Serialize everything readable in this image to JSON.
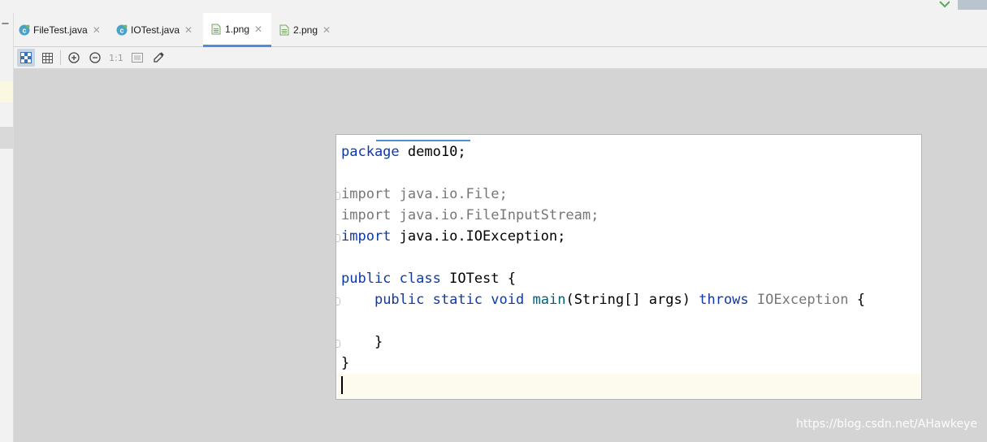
{
  "tabs": [
    {
      "label": "FileTest.java",
      "icon": "java-class-icon",
      "active": false
    },
    {
      "label": "IOTest.java",
      "icon": "java-class-icon",
      "active": false
    },
    {
      "label": "1.png",
      "icon": "image-file-icon",
      "active": true
    },
    {
      "label": "2.png",
      "icon": "image-file-icon",
      "active": false
    }
  ],
  "toolbar": {
    "actual_size_label": "1:1",
    "tools": [
      "chessboard-icon",
      "grid-icon",
      "zoom-in-icon",
      "zoom-out-icon",
      "actual-size",
      "fit-window-icon",
      "color-picker-icon"
    ]
  },
  "code": {
    "package_kw": "package",
    "package_name": "demo10;",
    "import1_kw": "import",
    "import1": "java.io.File;",
    "import2_kw": "import",
    "import2": "java.io.FileInputStream;",
    "import3_kw": "import",
    "import3": "java.io.IOException;",
    "class_public": "public",
    "class_kw": "class",
    "class_rest": "IOTest {",
    "m_public": "public",
    "m_static": "static",
    "m_void": "void",
    "m_name": "main",
    "m_params": "(String[] args)",
    "m_throws": "throws",
    "m_exc": "IOException",
    "m_brace": "{",
    "inner_close": "}",
    "outer_close": "}"
  },
  "watermark": "https://blog.csdn.net/AHawkeye",
  "colors": {
    "keyword": "#0e3aa8",
    "unused_import": "#777777",
    "method": "#00627a",
    "active_tab_underline": "#4a8fdd"
  }
}
